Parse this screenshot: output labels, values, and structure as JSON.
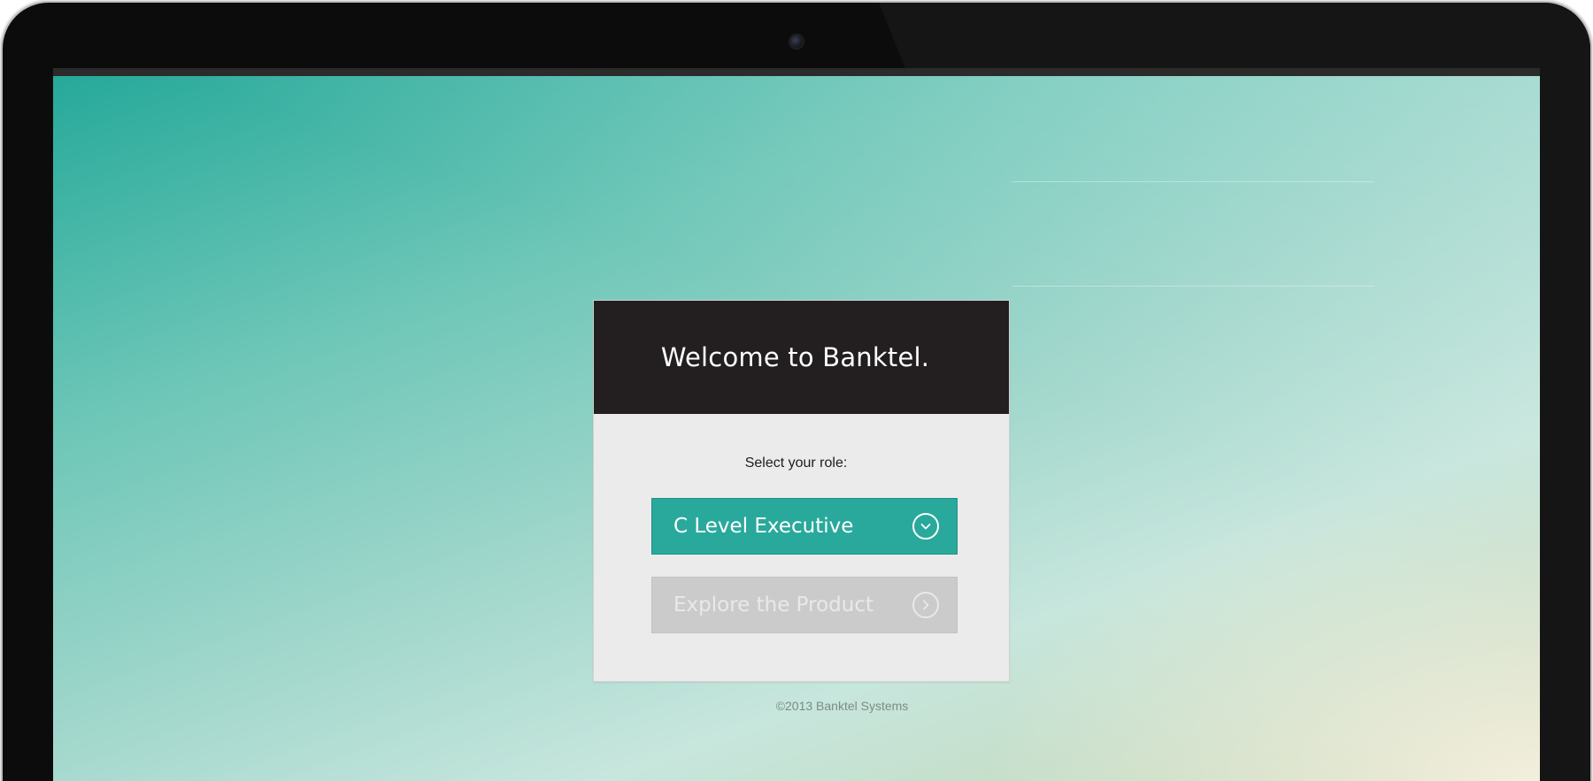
{
  "welcome": {
    "title": "Welcome to Banktel."
  },
  "role_select": {
    "label": "Select your role:",
    "selected_value": "C Level Executive",
    "icon": "chevron-down-circle-icon"
  },
  "explore": {
    "label": "Explore the Product",
    "icon": "chevron-right-circle-icon"
  },
  "footer": {
    "copyright": "©2013 Banktel Systems"
  },
  "colors": {
    "accent": "#29a99b",
    "header_bg": "#231f20",
    "card_bg": "#ebebeb",
    "disabled_button": "#cbcbcb"
  }
}
